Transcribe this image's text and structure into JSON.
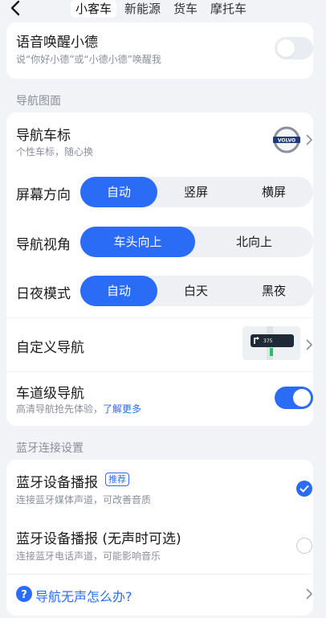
{
  "tabs": [
    {
      "label": "小客车",
      "active": true
    },
    {
      "label": "新能源",
      "active": false
    },
    {
      "label": "货车",
      "active": false
    },
    {
      "label": "摩托车",
      "active": false
    }
  ],
  "voice_wake": {
    "title": "语音唤醒小德",
    "subtitle": "说“你好小德”或“小德小德”唤醒我",
    "enabled": false
  },
  "nav_section": {
    "label": "导航图面",
    "car_icon": {
      "title": "导航车标",
      "subtitle": "个性车标，随心换",
      "icon": "volvo-logo"
    },
    "screen_orientation": {
      "title": "屏幕方向",
      "options": [
        "自动",
        "竖屏",
        "横屏"
      ],
      "selected": "自动"
    },
    "nav_view": {
      "title": "导航视角",
      "options": [
        "车头向上",
        "北向上"
      ],
      "selected": "车头向上"
    },
    "day_night": {
      "title": "日夜模式",
      "options": [
        "自动",
        "白天",
        "黑夜"
      ],
      "selected": "自动"
    },
    "custom_nav": {
      "title": "自定义导航",
      "preview_text": "375"
    },
    "lane_nav": {
      "title": "车道级导航",
      "subtitle": "高清导航抢先体验，",
      "link": "了解更多",
      "enabled": true
    }
  },
  "bt_section": {
    "label": "蓝牙连接设置",
    "media": {
      "title": "蓝牙设备播报",
      "badge": "推荐",
      "subtitle": "连接蓝牙媒体声道，可改善音质",
      "checked": true
    },
    "phone": {
      "title": "蓝牙设备播报 (无声时可选)",
      "subtitle": "连接蓝牙电话声道，可能影响音乐",
      "checked": false
    },
    "help": {
      "title": "导航无声怎么办?"
    }
  },
  "colors": {
    "accent": "#2b6cf6",
    "background": "#f2f3f7"
  }
}
